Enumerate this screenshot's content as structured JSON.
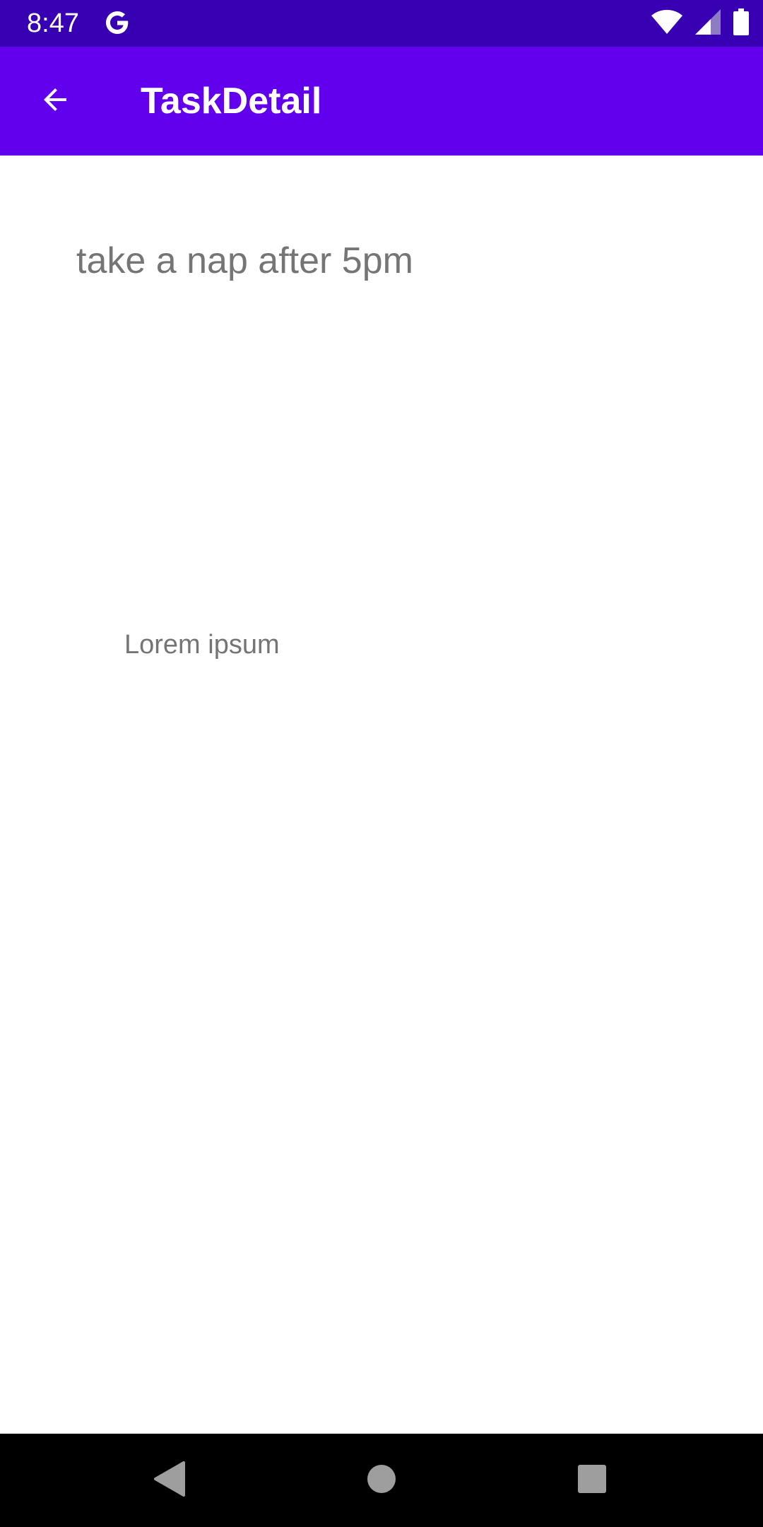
{
  "status_bar": {
    "time": "8:47",
    "icons": [
      "google-g-icon",
      "wifi-icon",
      "cellular-signal-icon",
      "battery-icon"
    ],
    "background": "#3700b3"
  },
  "app_bar": {
    "title": "TaskDetail",
    "back_icon": "arrow-back-icon",
    "background": "#6200ee"
  },
  "task": {
    "title": "take a nap after 5pm",
    "description": "Lorem ipsum"
  },
  "nav_bar": {
    "buttons": [
      "back-triangle-icon",
      "home-circle-icon",
      "recents-square-icon"
    ]
  },
  "colors": {
    "text_secondary": "#757575",
    "nav_icon": "#9e9e9e"
  }
}
